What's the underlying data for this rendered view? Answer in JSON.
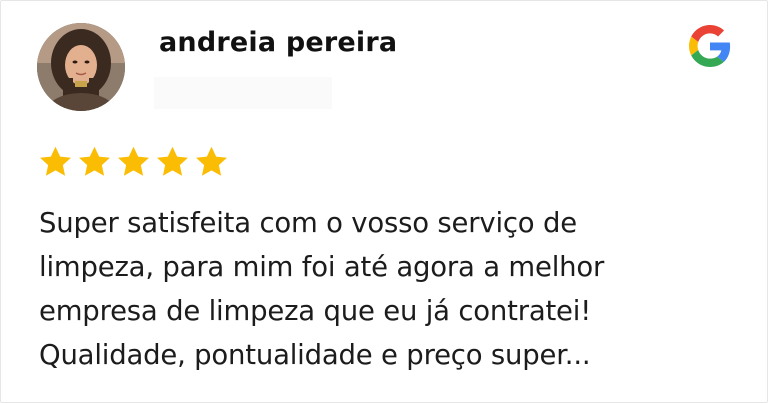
{
  "review": {
    "author": "andreia pereira",
    "rating": 5,
    "rating_max": 5,
    "star_color": "#FBBC04",
    "source_icon": "google-g-icon",
    "text_lines": [
      "Super satisfeita com o vosso serviço de",
      "limpeza, para mim foi até agora a melhor",
      "empresa de limpeza que eu já contratei!",
      "Qualidade, pontualidade e preço super..."
    ]
  }
}
